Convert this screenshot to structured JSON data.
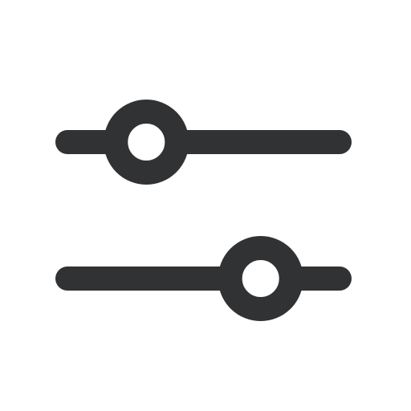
{
  "icon": {
    "name": "sliders-horizontal-icon",
    "color": "#313234",
    "background": "#ffffff"
  },
  "sliders": [
    {
      "name": "slider-top",
      "value": 0.29
    },
    {
      "name": "slider-bottom",
      "value": 0.71
    }
  ]
}
